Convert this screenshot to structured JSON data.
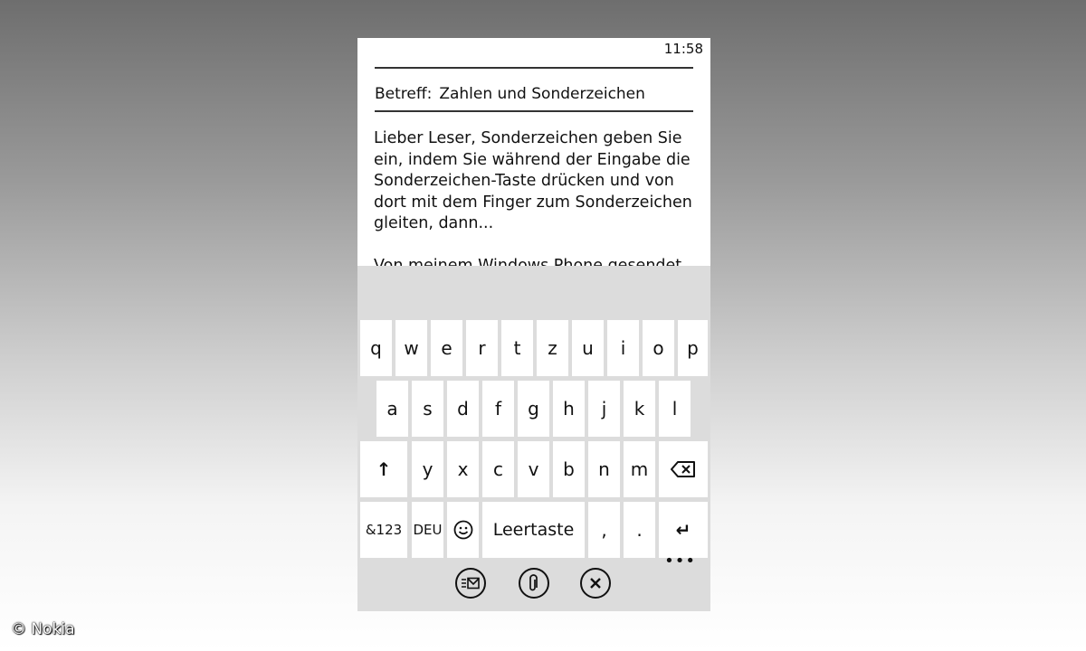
{
  "status": {
    "time": "11:58"
  },
  "email": {
    "subject_label": "Betreff:",
    "subject_value": "Zahlen und Sonderzeichen",
    "body_lines": [
      "Lieber Leser, Sonderzeichen geben Sie",
      "ein, indem Sie während der Eingabe die",
      "Sonderzeichen-Taste drücken und von",
      "dort mit dem Finger zum Sonderzeichen",
      "gleiten, dann..."
    ],
    "signature": "Von meinem Windows Phone gesendet"
  },
  "keyboard": {
    "row1": [
      "q",
      "w",
      "e",
      "r",
      "t",
      "z",
      "u",
      "i",
      "o",
      "p"
    ],
    "row2": [
      "a",
      "s",
      "d",
      "f",
      "g",
      "h",
      "j",
      "k",
      "l"
    ],
    "row3": [
      "y",
      "x",
      "c",
      "v",
      "b",
      "n",
      "m"
    ],
    "shift": "↑",
    "numbers": "&123",
    "language": "DEU",
    "space": "Leertaste",
    "comma": ",",
    "period": ".",
    "enter": "↵"
  },
  "appbar": {
    "icons": [
      "send-icon",
      "attach-icon",
      "cancel-icon"
    ],
    "more": "•••"
  },
  "copyright": "© Nokia"
}
